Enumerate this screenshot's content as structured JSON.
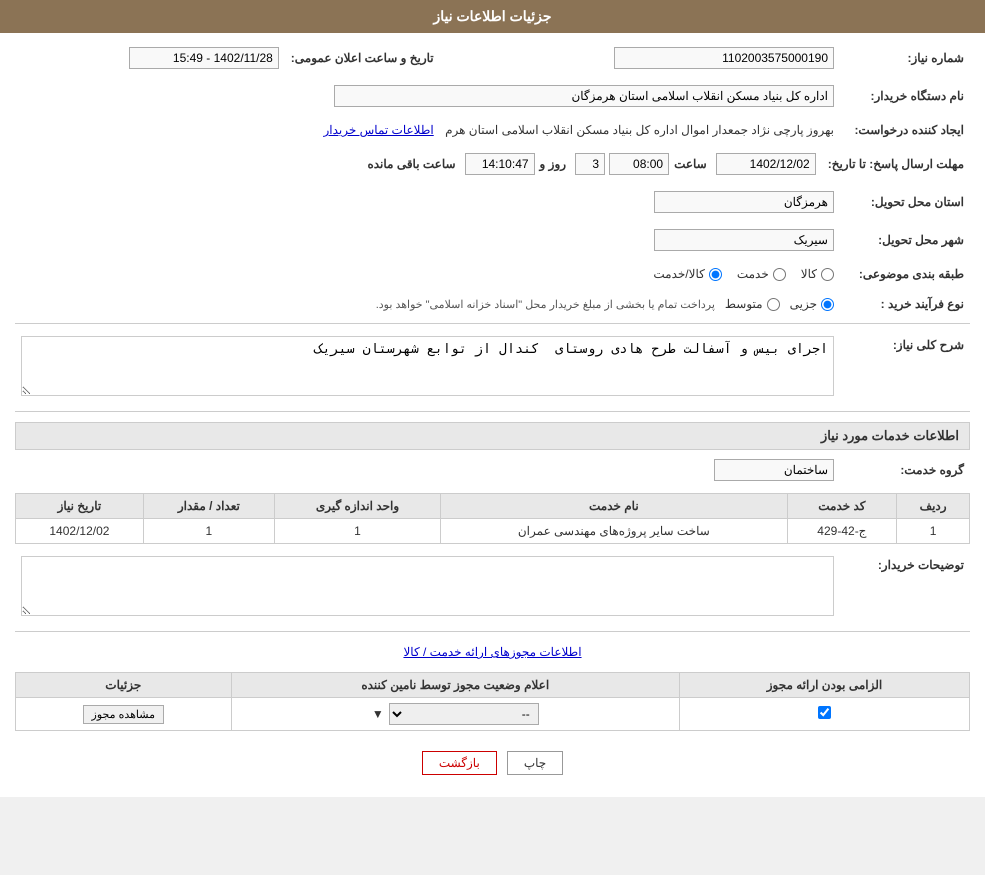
{
  "page": {
    "title": "جزئیات اطلاعات نیاز",
    "colors": {
      "header_bg": "#8B7355",
      "header_text": "#ffffff",
      "table_header_bg": "#e8e8e8"
    }
  },
  "header": {
    "title": "جزئیات اطلاعات نیاز"
  },
  "fields": {
    "need_number_label": "شماره نیاز:",
    "need_number_value": "1102003575000190",
    "announce_date_label": "تاریخ و ساعت اعلان عمومی:",
    "announce_date_value": "1402/11/28 - 15:49",
    "buyer_org_label": "نام دستگاه خریدار:",
    "buyer_org_value": "اداره کل بنیاد مسکن انقلاب اسلامی استان هرمزگان",
    "creator_label": "ایجاد کننده درخواست:",
    "creator_value": "بهروز  پارچی نژاد جمعدار اموال اداره کل بنیاد مسکن انقلاب اسلامی استان هرم",
    "creator_link": "اطلاعات تماس خریدار",
    "send_deadline_label": "مهلت ارسال پاسخ: تا تاریخ:",
    "send_date": "1402/12/02",
    "send_time": "08:00",
    "send_days": "3",
    "send_remaining": "14:10:47",
    "send_days_label": "روز و",
    "send_remaining_label": "ساعت باقی مانده",
    "delivery_province_label": "استان محل تحویل:",
    "delivery_province_value": "هرمزگان",
    "delivery_city_label": "شهر محل تحویل:",
    "delivery_city_value": "سیریک",
    "category_label": "طبقه بندی موضوعی:",
    "category_options": [
      "کالا",
      "خدمت",
      "کالا/خدمت"
    ],
    "category_selected": "کالا/خدمت",
    "process_label": "نوع فرآیند خرید :",
    "process_options": [
      "جزیی",
      "متوسط"
    ],
    "process_selected": "جزیی",
    "process_note": "پرداخت تمام یا بخشی از مبلغ خریدار محل \"اسناد خزانه اسلامی\" خواهد بود."
  },
  "general_desc": {
    "label": "شرح کلی نیاز:",
    "value": "اجرای بیس و آسفالت طرح هادی روستای  کندال از توابع شهرستان سیریک"
  },
  "services_section": {
    "title": "اطلاعات خدمات مورد نیاز",
    "service_group_label": "گروه خدمت:",
    "service_group_value": "ساختمان",
    "table_headers": [
      "ردیف",
      "کد خدمت",
      "نام خدمت",
      "واحد اندازه گیری",
      "تعداد / مقدار",
      "تاریخ نیاز"
    ],
    "table_rows": [
      {
        "row": "1",
        "code": "ج-42-429",
        "name": "ساخت سایر پروژه‌های مهندسی عمران",
        "unit": "1",
        "quantity": "1",
        "date": "1402/12/02"
      }
    ]
  },
  "buyer_desc": {
    "label": "توضیحات خریدار:",
    "value": ""
  },
  "permissions_section": {
    "title": "اطلاعات مجوزهای ارائه خدمت / کالا",
    "table_headers": [
      "الزامی بودن ارائه مجوز",
      "اعلام وضعیت مجوز توسط نامین کننده",
      "جزئیات"
    ],
    "table_rows": [
      {
        "required": true,
        "status": "--",
        "details_btn": "مشاهده مجوز"
      }
    ]
  },
  "buttons": {
    "print": "چاپ",
    "back": "بازگشت"
  }
}
